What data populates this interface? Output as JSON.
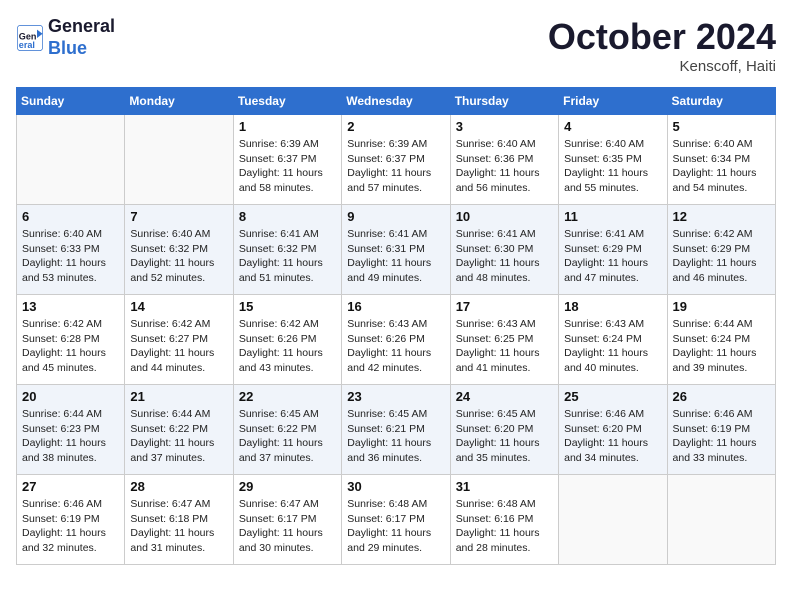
{
  "header": {
    "logo_line1": "General",
    "logo_line2": "Blue",
    "month": "October 2024",
    "location": "Kenscoff, Haiti"
  },
  "days_of_week": [
    "Sunday",
    "Monday",
    "Tuesday",
    "Wednesday",
    "Thursday",
    "Friday",
    "Saturday"
  ],
  "weeks": [
    [
      {
        "num": "",
        "sunrise": "",
        "sunset": "",
        "daylight": ""
      },
      {
        "num": "",
        "sunrise": "",
        "sunset": "",
        "daylight": ""
      },
      {
        "num": "1",
        "sunrise": "Sunrise: 6:39 AM",
        "sunset": "Sunset: 6:37 PM",
        "daylight": "Daylight: 11 hours and 58 minutes."
      },
      {
        "num": "2",
        "sunrise": "Sunrise: 6:39 AM",
        "sunset": "Sunset: 6:37 PM",
        "daylight": "Daylight: 11 hours and 57 minutes."
      },
      {
        "num": "3",
        "sunrise": "Sunrise: 6:40 AM",
        "sunset": "Sunset: 6:36 PM",
        "daylight": "Daylight: 11 hours and 56 minutes."
      },
      {
        "num": "4",
        "sunrise": "Sunrise: 6:40 AM",
        "sunset": "Sunset: 6:35 PM",
        "daylight": "Daylight: 11 hours and 55 minutes."
      },
      {
        "num": "5",
        "sunrise": "Sunrise: 6:40 AM",
        "sunset": "Sunset: 6:34 PM",
        "daylight": "Daylight: 11 hours and 54 minutes."
      }
    ],
    [
      {
        "num": "6",
        "sunrise": "Sunrise: 6:40 AM",
        "sunset": "Sunset: 6:33 PM",
        "daylight": "Daylight: 11 hours and 53 minutes."
      },
      {
        "num": "7",
        "sunrise": "Sunrise: 6:40 AM",
        "sunset": "Sunset: 6:32 PM",
        "daylight": "Daylight: 11 hours and 52 minutes."
      },
      {
        "num": "8",
        "sunrise": "Sunrise: 6:41 AM",
        "sunset": "Sunset: 6:32 PM",
        "daylight": "Daylight: 11 hours and 51 minutes."
      },
      {
        "num": "9",
        "sunrise": "Sunrise: 6:41 AM",
        "sunset": "Sunset: 6:31 PM",
        "daylight": "Daylight: 11 hours and 49 minutes."
      },
      {
        "num": "10",
        "sunrise": "Sunrise: 6:41 AM",
        "sunset": "Sunset: 6:30 PM",
        "daylight": "Daylight: 11 hours and 48 minutes."
      },
      {
        "num": "11",
        "sunrise": "Sunrise: 6:41 AM",
        "sunset": "Sunset: 6:29 PM",
        "daylight": "Daylight: 11 hours and 47 minutes."
      },
      {
        "num": "12",
        "sunrise": "Sunrise: 6:42 AM",
        "sunset": "Sunset: 6:29 PM",
        "daylight": "Daylight: 11 hours and 46 minutes."
      }
    ],
    [
      {
        "num": "13",
        "sunrise": "Sunrise: 6:42 AM",
        "sunset": "Sunset: 6:28 PM",
        "daylight": "Daylight: 11 hours and 45 minutes."
      },
      {
        "num": "14",
        "sunrise": "Sunrise: 6:42 AM",
        "sunset": "Sunset: 6:27 PM",
        "daylight": "Daylight: 11 hours and 44 minutes."
      },
      {
        "num": "15",
        "sunrise": "Sunrise: 6:42 AM",
        "sunset": "Sunset: 6:26 PM",
        "daylight": "Daylight: 11 hours and 43 minutes."
      },
      {
        "num": "16",
        "sunrise": "Sunrise: 6:43 AM",
        "sunset": "Sunset: 6:26 PM",
        "daylight": "Daylight: 11 hours and 42 minutes."
      },
      {
        "num": "17",
        "sunrise": "Sunrise: 6:43 AM",
        "sunset": "Sunset: 6:25 PM",
        "daylight": "Daylight: 11 hours and 41 minutes."
      },
      {
        "num": "18",
        "sunrise": "Sunrise: 6:43 AM",
        "sunset": "Sunset: 6:24 PM",
        "daylight": "Daylight: 11 hours and 40 minutes."
      },
      {
        "num": "19",
        "sunrise": "Sunrise: 6:44 AM",
        "sunset": "Sunset: 6:24 PM",
        "daylight": "Daylight: 11 hours and 39 minutes."
      }
    ],
    [
      {
        "num": "20",
        "sunrise": "Sunrise: 6:44 AM",
        "sunset": "Sunset: 6:23 PM",
        "daylight": "Daylight: 11 hours and 38 minutes."
      },
      {
        "num": "21",
        "sunrise": "Sunrise: 6:44 AM",
        "sunset": "Sunset: 6:22 PM",
        "daylight": "Daylight: 11 hours and 37 minutes."
      },
      {
        "num": "22",
        "sunrise": "Sunrise: 6:45 AM",
        "sunset": "Sunset: 6:22 PM",
        "daylight": "Daylight: 11 hours and 37 minutes."
      },
      {
        "num": "23",
        "sunrise": "Sunrise: 6:45 AM",
        "sunset": "Sunset: 6:21 PM",
        "daylight": "Daylight: 11 hours and 36 minutes."
      },
      {
        "num": "24",
        "sunrise": "Sunrise: 6:45 AM",
        "sunset": "Sunset: 6:20 PM",
        "daylight": "Daylight: 11 hours and 35 minutes."
      },
      {
        "num": "25",
        "sunrise": "Sunrise: 6:46 AM",
        "sunset": "Sunset: 6:20 PM",
        "daylight": "Daylight: 11 hours and 34 minutes."
      },
      {
        "num": "26",
        "sunrise": "Sunrise: 6:46 AM",
        "sunset": "Sunset: 6:19 PM",
        "daylight": "Daylight: 11 hours and 33 minutes."
      }
    ],
    [
      {
        "num": "27",
        "sunrise": "Sunrise: 6:46 AM",
        "sunset": "Sunset: 6:19 PM",
        "daylight": "Daylight: 11 hours and 32 minutes."
      },
      {
        "num": "28",
        "sunrise": "Sunrise: 6:47 AM",
        "sunset": "Sunset: 6:18 PM",
        "daylight": "Daylight: 11 hours and 31 minutes."
      },
      {
        "num": "29",
        "sunrise": "Sunrise: 6:47 AM",
        "sunset": "Sunset: 6:17 PM",
        "daylight": "Daylight: 11 hours and 30 minutes."
      },
      {
        "num": "30",
        "sunrise": "Sunrise: 6:48 AM",
        "sunset": "Sunset: 6:17 PM",
        "daylight": "Daylight: 11 hours and 29 minutes."
      },
      {
        "num": "31",
        "sunrise": "Sunrise: 6:48 AM",
        "sunset": "Sunset: 6:16 PM",
        "daylight": "Daylight: 11 hours and 28 minutes."
      },
      {
        "num": "",
        "sunrise": "",
        "sunset": "",
        "daylight": ""
      },
      {
        "num": "",
        "sunrise": "",
        "sunset": "",
        "daylight": ""
      }
    ]
  ]
}
